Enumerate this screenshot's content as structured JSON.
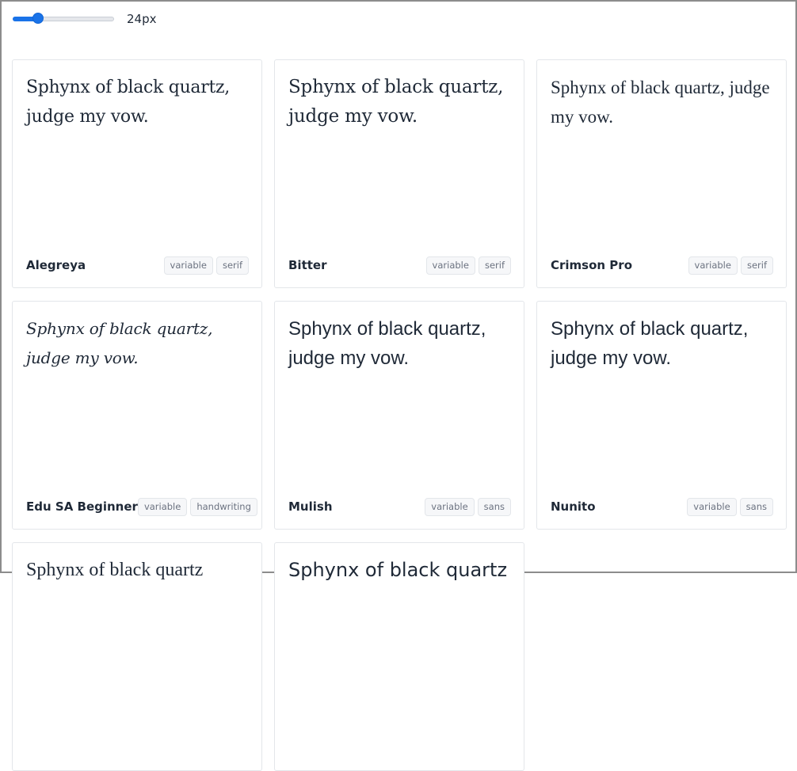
{
  "controls": {
    "size_slider": {
      "min": 8,
      "max": 72,
      "value": 24
    },
    "size_label": "24px"
  },
  "sample_text": "Sphynx of black quartz, judge my vow.",
  "fonts": [
    {
      "name": "Alegreya",
      "tags": [
        "variable",
        "serif"
      ]
    },
    {
      "name": "Bitter",
      "tags": [
        "variable",
        "serif"
      ]
    },
    {
      "name": "Crimson Pro",
      "tags": [
        "variable",
        "serif"
      ]
    },
    {
      "name": "Edu SA Beginner",
      "tags": [
        "variable",
        "handwriting"
      ]
    },
    {
      "name": "Mulish",
      "tags": [
        "variable",
        "sans"
      ]
    },
    {
      "name": "Nunito",
      "tags": [
        "variable",
        "sans"
      ]
    },
    {
      "sample_partial": "Sphynx of black quartz"
    },
    {
      "sample_partial": "Sphynx of black quartz"
    }
  ],
  "colors": {
    "accent": "#1a73e8",
    "text": "#1f2937",
    "muted": "#6b7280",
    "border": "#e3e6ea"
  }
}
